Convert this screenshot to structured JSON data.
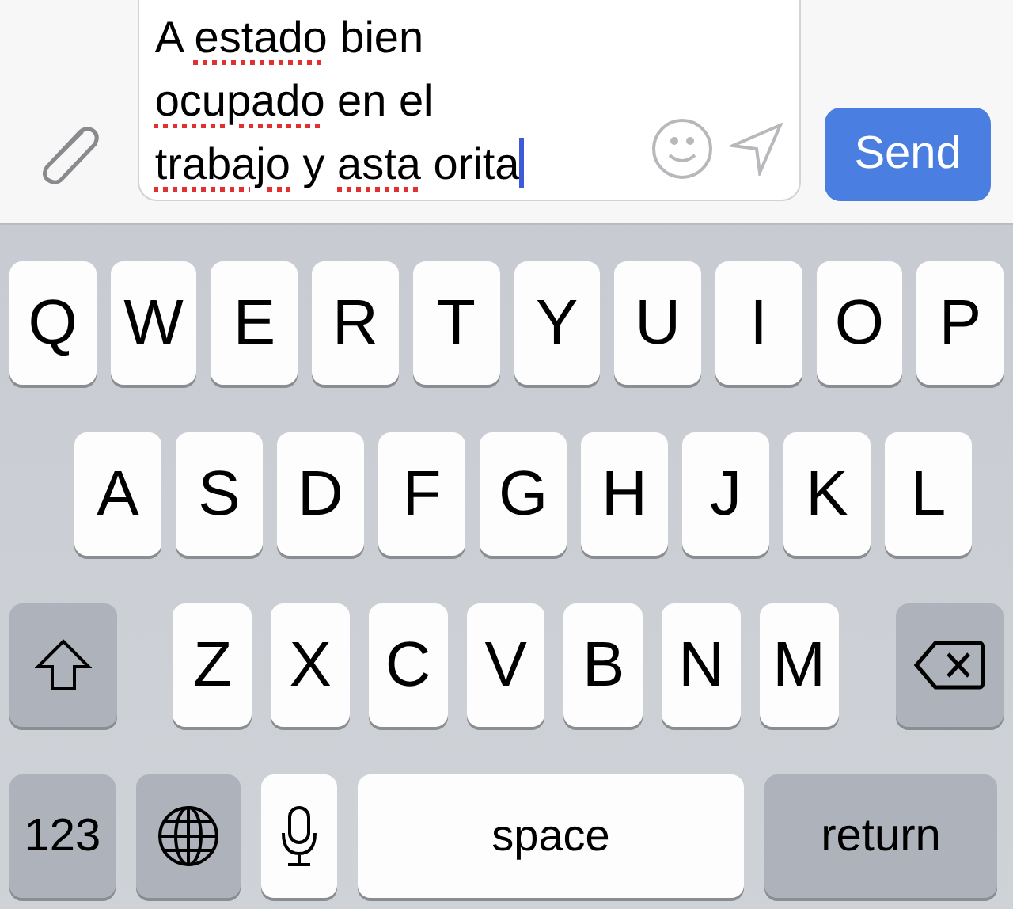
{
  "compose": {
    "message": [
      {
        "text": "A ",
        "misspelled": false
      },
      {
        "text": "estado",
        "misspelled": true
      },
      {
        "text": " bien ",
        "misspelled": false
      },
      {
        "text": "ocupado",
        "misspelled": true
      },
      {
        "text": " en el ",
        "misspelled": false
      },
      {
        "text": "trabajo",
        "misspelled": true
      },
      {
        "text": " y ",
        "misspelled": false
      },
      {
        "text": "asta",
        "misspelled": true
      },
      {
        "text": " orita",
        "misspelled": false
      }
    ],
    "send_button": "Send"
  },
  "keyboard": {
    "rows": [
      {
        "keys": [
          {
            "kind": "letter",
            "label": "Q"
          },
          {
            "kind": "letter",
            "label": "W"
          },
          {
            "kind": "letter",
            "label": "E"
          },
          {
            "kind": "letter",
            "label": "R"
          },
          {
            "kind": "letter",
            "label": "T"
          },
          {
            "kind": "letter",
            "label": "Y"
          },
          {
            "kind": "letter",
            "label": "U"
          },
          {
            "kind": "letter",
            "label": "I"
          },
          {
            "kind": "letter",
            "label": "O"
          },
          {
            "kind": "letter",
            "label": "P"
          }
        ]
      },
      {
        "keys": [
          {
            "kind": "letter",
            "label": "A"
          },
          {
            "kind": "letter",
            "label": "S"
          },
          {
            "kind": "letter",
            "label": "D"
          },
          {
            "kind": "letter",
            "label": "F"
          },
          {
            "kind": "letter",
            "label": "G"
          },
          {
            "kind": "letter",
            "label": "H"
          },
          {
            "kind": "letter",
            "label": "J"
          },
          {
            "kind": "letter",
            "label": "K"
          },
          {
            "kind": "letter",
            "label": "L"
          }
        ]
      },
      {
        "keys": [
          {
            "kind": "shift"
          },
          {
            "kind": "letter",
            "label": "Z"
          },
          {
            "kind": "letter",
            "label": "X"
          },
          {
            "kind": "letter",
            "label": "C"
          },
          {
            "kind": "letter",
            "label": "V"
          },
          {
            "kind": "letter",
            "label": "B"
          },
          {
            "kind": "letter",
            "label": "N"
          },
          {
            "kind": "letter",
            "label": "M"
          },
          {
            "kind": "delete"
          }
        ]
      },
      {
        "keys": [
          {
            "kind": "numbers",
            "label": "123"
          },
          {
            "kind": "globe"
          },
          {
            "kind": "mic"
          },
          {
            "kind": "space",
            "label": "space"
          },
          {
            "kind": "return",
            "label": "return"
          }
        ]
      }
    ]
  }
}
